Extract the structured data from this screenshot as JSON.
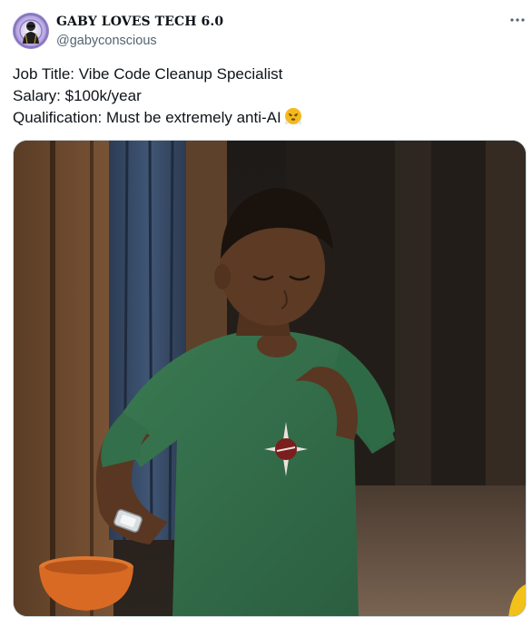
{
  "post": {
    "author": {
      "display_name": "GABY LOVES TECH 6.0",
      "handle": "@gabyconscious",
      "avatar_icon": "avatar-spiral-icon"
    },
    "more_icon": "more-horizontal-icon",
    "text_lines": [
      "Job Title: Vibe Code Cleanup Specialist",
      "Salary: $100k/year",
      "Qualification: Must be extremely anti-AI"
    ],
    "trailing_emoji": "face-with-steam-from-nose",
    "media": {
      "type": "image",
      "subject_icon": "boy-in-green-shirt-image"
    }
  },
  "colors": {
    "text": "#0f1419",
    "secondary": "#536471",
    "border": "#cfd9de",
    "shirt": "#2f6b45",
    "emoji": "#f5b91d"
  }
}
